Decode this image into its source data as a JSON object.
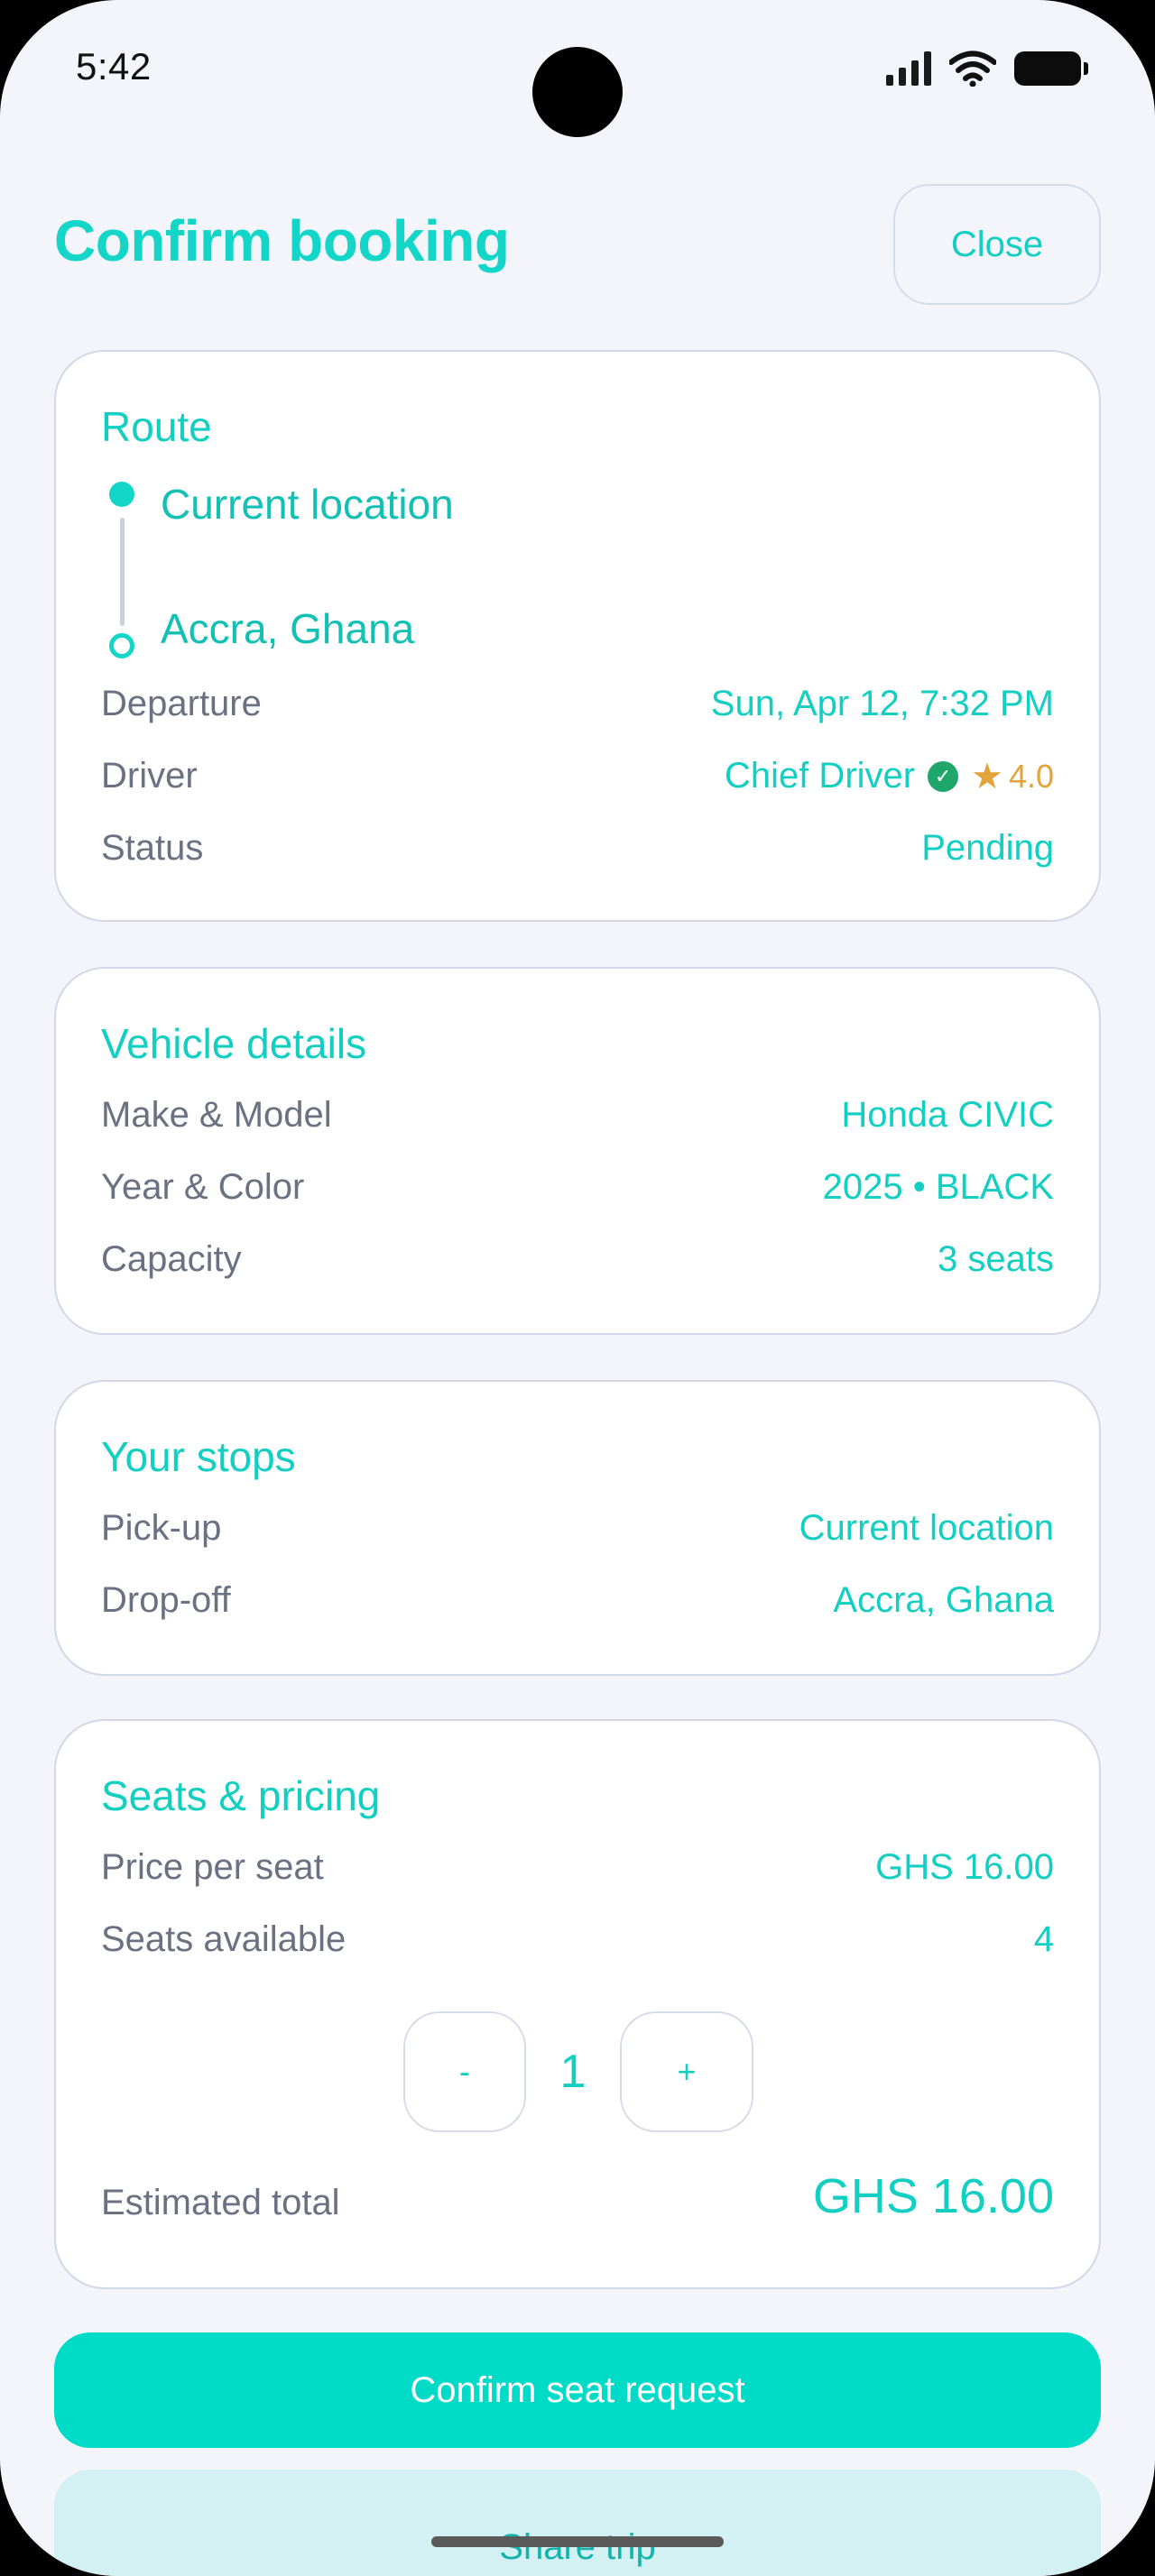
{
  "status_bar": {
    "time": "5:42"
  },
  "header": {
    "title": "Confirm booking",
    "close_label": "Close"
  },
  "route": {
    "title": "Route",
    "from": "Current location",
    "to": "Accra, Ghana",
    "rows": {
      "departure": {
        "label": "Departure",
        "value": "Sun, Apr 12, 7:32 PM"
      },
      "driver": {
        "label": "Driver",
        "value": "Chief Driver",
        "rating": "4.0"
      },
      "status": {
        "label": "Status",
        "value": "Pending"
      }
    }
  },
  "vehicle": {
    "title": "Vehicle details",
    "rows": [
      {
        "label": "Make & Model",
        "value": "Honda CIVIC"
      },
      {
        "label": "Year & Color",
        "value": "2025 • BLACK"
      },
      {
        "label": "Capacity",
        "value": "3 seats"
      }
    ]
  },
  "stops": {
    "title": "Your stops",
    "rows": [
      {
        "label": "Pick-up",
        "value": "Current location"
      },
      {
        "label": "Drop-off",
        "value": "Accra, Ghana"
      }
    ]
  },
  "pricing": {
    "title": "Seats & pricing",
    "rows": [
      {
        "label": "Price per seat",
        "value": "GHS 16.00"
      },
      {
        "label": "Seats available",
        "value": "4"
      }
    ],
    "stepper": {
      "minus_label": "-",
      "value": "1",
      "plus_label": "+"
    },
    "total_label": "Estimated total",
    "total_value": "GHS 16.00"
  },
  "actions": {
    "confirm_label": "Confirm seat request",
    "share_label": "Share trip"
  },
  "icons": [
    "verified-icon",
    "star-icon",
    "signal-icon",
    "wifi-icon",
    "battery-icon"
  ],
  "colors": {
    "accent": "#13d6c8",
    "confirm_bg": "#00dbc8",
    "share_bg": "#d3f0f2",
    "rating": "#e2a33a",
    "verified": "#1fa76b"
  }
}
